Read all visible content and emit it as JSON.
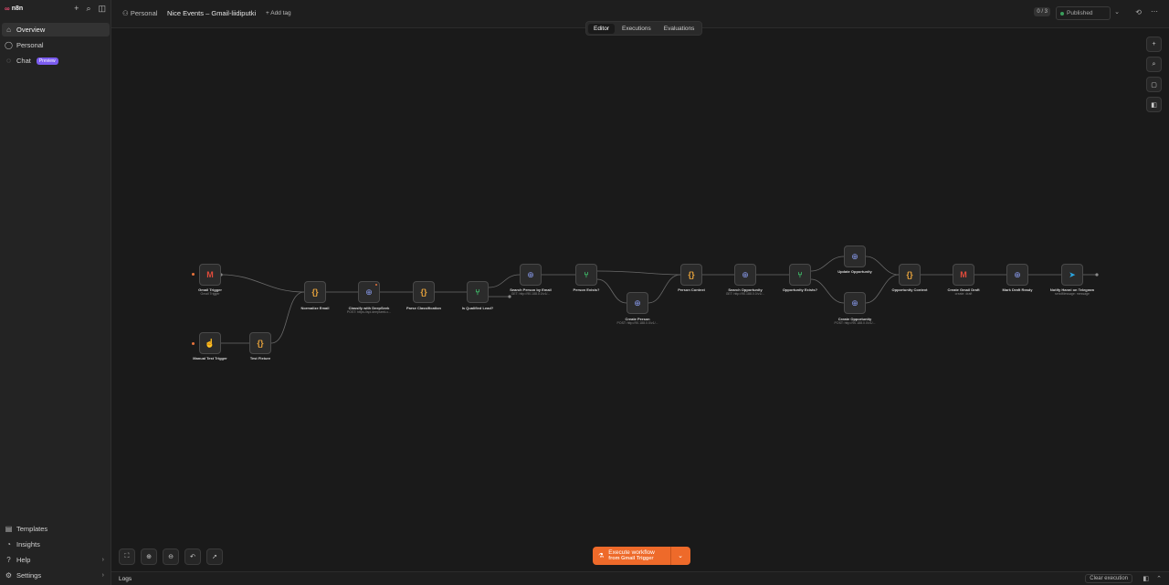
{
  "app": {
    "logo_text": "n8n",
    "logo_mark": "∞"
  },
  "sidebar": {
    "top_icons": [
      "+",
      "⌕",
      "◫"
    ],
    "items": [
      {
        "label": "Overview",
        "icon": "⌂",
        "active": true
      },
      {
        "label": "Personal",
        "icon": "◯"
      },
      {
        "label": "Chat",
        "icon": "◌",
        "badge": "Preview"
      }
    ],
    "bottom_items": [
      {
        "label": "Templates",
        "icon": "▤"
      },
      {
        "label": "Insights",
        "icon": "◔"
      },
      {
        "label": "Help",
        "icon": "?",
        "chevron": "›"
      },
      {
        "label": "Settings",
        "icon": "⚙",
        "chevron": "›"
      }
    ]
  },
  "header": {
    "breadcrumb": "Personal",
    "breadcrumb_icon": "⚇",
    "workflow_title": "Nice Events – Gmail-liidiputki",
    "add_tag": "+ Add tag",
    "counter": "0 / 3",
    "published": "Published",
    "chevron": "⌄",
    "history_icon": "⟲",
    "more_icon": "⋯"
  },
  "tabs": [
    {
      "label": "Editor",
      "active": true
    },
    {
      "label": "Executions"
    },
    {
      "label": "Evaluations"
    }
  ],
  "nodes": {
    "gmail_trigger": {
      "glyph": "M",
      "title": "Gmail Trigger",
      "sub": "Gmail Trigger"
    },
    "manual_trigger": {
      "glyph": "☝",
      "title": "Manual Test Trigger",
      "sub": ""
    },
    "test_fixture": {
      "glyph": "{}",
      "title": "Test Fixture",
      "sub": ""
    },
    "normalize_email": {
      "glyph": "{}",
      "title": "Normalize Email",
      "sub": ""
    },
    "classify": {
      "glyph": "⊕",
      "title": "Classify with DeepSeek",
      "sub": "POST: https://api.deepseek.c..."
    },
    "parse_class": {
      "glyph": "{}",
      "title": "Parse Classification",
      "sub": ""
    },
    "is_qualified": {
      "glyph": "⑂",
      "title": "Is Qualified Lead?",
      "sub": ""
    },
    "search_person": {
      "glyph": "⊕",
      "title": "Search Person by Email",
      "sub": "GET: http://90.188.0.0/v1/..."
    },
    "person_exists": {
      "glyph": "⑂",
      "title": "Person Exists?",
      "sub": ""
    },
    "create_person": {
      "glyph": "⊕",
      "title": "Create Person",
      "sub": "POST: http://90.188.0.0/v1/..."
    },
    "person_context": {
      "glyph": "{}",
      "title": "Person Context",
      "sub": ""
    },
    "search_opp": {
      "glyph": "⊕",
      "title": "Search Opportunity",
      "sub": "GET: http://90.188.0.0/v1/..."
    },
    "opp_exists": {
      "glyph": "⑂",
      "title": "Opportunity Exists?",
      "sub": ""
    },
    "update_opp": {
      "glyph": "⊕",
      "title": "Update Opportunity",
      "sub": ""
    },
    "create_opp": {
      "glyph": "⊕",
      "title": "Create Opportunity",
      "sub": "POST: http://90.188.0.0/v1/..."
    },
    "opp_context": {
      "glyph": "{}",
      "title": "Opportunity Context",
      "sub": ""
    },
    "create_draft": {
      "glyph": "M",
      "title": "Create Gmail Draft",
      "sub": "create: draft"
    },
    "mark_ready": {
      "glyph": "⊕",
      "title": "Mark Draft Ready",
      "sub": ""
    },
    "notify_tg": {
      "glyph": "➤",
      "title": "Notify Hanni on Telegram",
      "sub": "sendMessage: message"
    }
  },
  "right_tools": [
    "+",
    "⌕",
    "▢",
    "◧"
  ],
  "bottom_tools": [
    "⛶",
    "⊕",
    "⊖",
    "↶",
    "➚"
  ],
  "execute": {
    "label": "Execute workflow",
    "sub": "from Gmail Trigger",
    "icon": "⚗",
    "caret": "⌄"
  },
  "logs": {
    "label": "Logs",
    "clear": "Clear execution",
    "icon_a": "◧",
    "icon_b": "⌃"
  },
  "colors": {
    "accent": "#ee6a2a",
    "trigger": "#e8733c",
    "code": "#e8a33c",
    "if": "#3fbf6b",
    "http": "#8a9cf0"
  }
}
